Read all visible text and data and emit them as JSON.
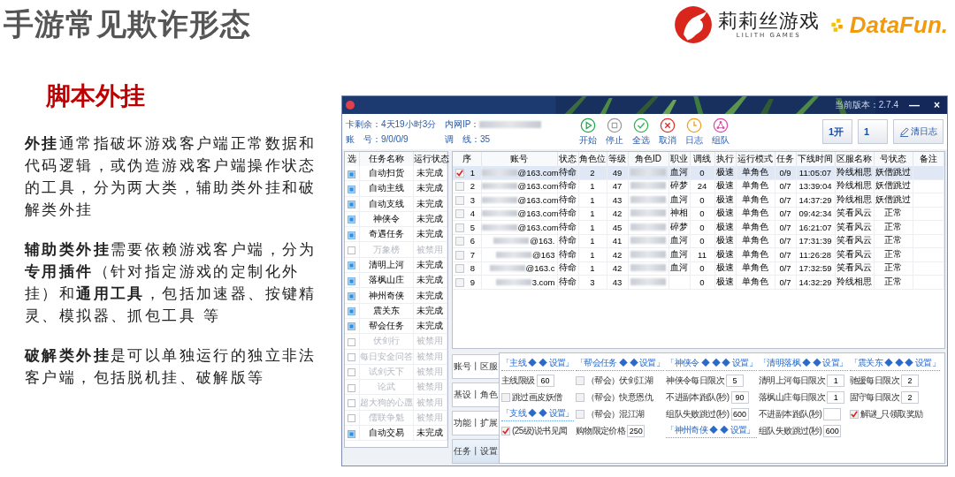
{
  "slide": {
    "title": "手游常见欺诈形态",
    "lilith_name": "莉莉丝游戏",
    "lilith_sub": "LILITH GAMES",
    "datafun": "DataFun."
  },
  "heading": "脚本外挂",
  "paragraphs": [
    "**外挂**通常指破坏游戏客户端正常数据和代码逻辑，或伪造游戏客户端操作状态的工具，分为两大类，辅助类外挂和破解类外挂",
    "**辅助类外挂**需要依赖游戏客户端，分为**专用插件**（针对指定游戏的定制化外挂）和**通用工具**，包括加速器、按键精灵、模拟器、抓包工具 等",
    "**破解类外挂**是可以单独运行的独立非法客户端，包括脱机挂、破解版等"
  ],
  "app_window": {
    "version": "当前版本：2.7.4",
    "minimize": "—",
    "close": "×",
    "info": [
      {
        "label": "卡剩余：",
        "value": "4天19小时3分"
      },
      {
        "label": "账　号：",
        "value": "9/0/0/9"
      },
      {
        "label": "内网IP：",
        "redacted": true
      },
      {
        "label": "调　线：",
        "value": "35"
      }
    ],
    "toolbar": [
      {
        "kind": "play",
        "label": "开始"
      },
      {
        "kind": "stop",
        "label": "停止"
      },
      {
        "kind": "check",
        "label": "全选"
      },
      {
        "kind": "cancel",
        "label": "取消"
      },
      {
        "kind": "log",
        "label": "日志"
      },
      {
        "kind": "team",
        "label": "组队"
      }
    ],
    "right_buttons": [
      "1开",
      "1"
    ],
    "clear_log": "清日志",
    "task_list": {
      "columns": [
        "选",
        "任务名称",
        "运行状态"
      ],
      "rows": [
        {
          "checked": true,
          "disabled": false,
          "name": "自动扫货",
          "status": "未完成"
        },
        {
          "checked": true,
          "disabled": false,
          "name": "自动主线",
          "status": "未完成"
        },
        {
          "checked": true,
          "disabled": false,
          "name": "自动支线",
          "status": "未完成"
        },
        {
          "checked": true,
          "disabled": false,
          "name": "神侠令",
          "status": "未完成"
        },
        {
          "checked": true,
          "disabled": false,
          "name": "奇遇任务",
          "status": "未完成"
        },
        {
          "checked": false,
          "disabled": true,
          "name": "万象榜",
          "status": "被禁用"
        },
        {
          "checked": true,
          "disabled": false,
          "name": "清明上河",
          "status": "未完成"
        },
        {
          "checked": true,
          "disabled": false,
          "name": "落枫山庄",
          "status": "未完成"
        },
        {
          "checked": true,
          "disabled": false,
          "name": "神州奇侠",
          "status": "未完成"
        },
        {
          "checked": true,
          "disabled": false,
          "name": "震关东",
          "status": "未完成"
        },
        {
          "checked": true,
          "disabled": false,
          "name": "帮会任务",
          "status": "未完成"
        },
        {
          "checked": false,
          "disabled": true,
          "name": "伏剑行",
          "status": "被禁用"
        },
        {
          "checked": false,
          "disabled": true,
          "name": "每日安全问答",
          "status": "被禁用"
        },
        {
          "checked": false,
          "disabled": true,
          "name": "试剑天下",
          "status": "被禁用"
        },
        {
          "checked": false,
          "disabled": true,
          "name": "论武",
          "status": "被禁用"
        },
        {
          "checked": false,
          "disabled": true,
          "name": "超大狗的心愿",
          "status": "被禁用"
        },
        {
          "checked": false,
          "disabled": true,
          "name": "儒联争魁",
          "status": "被禁用"
        },
        {
          "checked": true,
          "disabled": false,
          "name": "自动交易",
          "status": "未完成"
        }
      ]
    },
    "accounts": {
      "columns": [
        "序",
        "账号",
        "状态",
        "角色位",
        "等级",
        "角色ID",
        "职业",
        "调线",
        "执行",
        "运行模式",
        "任务",
        "下线时间",
        "区服名称",
        "号状态",
        "备注"
      ],
      "rows": [
        {
          "selected": true,
          "checked": true,
          "index": "1",
          "account": "@163.com",
          "state": "待命",
          "slot": "2",
          "level_text": "49",
          "job": "血河",
          "line": "0",
          "exec": "极速",
          "mode": "单角色",
          "task": "0/9",
          "offline": "11:05:07",
          "server": "羚线相思",
          "account_status": "妖僧跳过"
        },
        {
          "selected": false,
          "checked": false,
          "index": "2",
          "account": "@163.com",
          "state": "待命",
          "slot": "1",
          "level_text": "47",
          "job": "碎梦",
          "line": "24",
          "exec": "极速",
          "mode": "单角色",
          "task": "0/7",
          "offline": "13:39:04",
          "server": "羚线相思",
          "account_status": "妖僧跳过"
        },
        {
          "selected": false,
          "checked": false,
          "index": "3",
          "account": "@163.com",
          "state": "待命",
          "slot": "1",
          "level_text": "43",
          "job": "血河",
          "line": "0",
          "exec": "极速",
          "mode": "单角色",
          "task": "0/7",
          "offline": "14:37:29",
          "server": "羚线相思",
          "account_status": "妖僧跳过"
        },
        {
          "selected": false,
          "checked": false,
          "index": "4",
          "account": "@163.com",
          "state": "待命",
          "slot": "1",
          "level_text": "42",
          "job": "神相",
          "line": "0",
          "exec": "极速",
          "mode": "单角色",
          "task": "0/7",
          "offline": "09:42:34",
          "server": "笑看风云",
          "account_status": "正常"
        },
        {
          "selected": false,
          "checked": false,
          "index": "5",
          "account": "@163.com",
          "state": "待命",
          "slot": "1",
          "level_text": "45",
          "job": "碎梦",
          "line": "0",
          "exec": "极速",
          "mode": "单角色",
          "task": "0/7",
          "offline": "16:21:07",
          "server": "笑看风云",
          "account_status": "正常"
        },
        {
          "selected": false,
          "checked": false,
          "index": "6",
          "account": "@163.",
          "state": "待命",
          "slot": "1",
          "level_text": "41",
          "job": "血河",
          "line": "0",
          "exec": "极速",
          "mode": "单角色",
          "task": "0/7",
          "offline": "17:31:39",
          "server": "笑看风云",
          "account_status": "正常"
        },
        {
          "selected": false,
          "checked": false,
          "index": "7",
          "account": "@163",
          "state": "待命",
          "slot": "1",
          "level_text": "42",
          "job": "血河",
          "line": "11",
          "exec": "极速",
          "mode": "单角色",
          "task": "0/7",
          "offline": "11:26:28",
          "server": "笑看风云",
          "account_status": "正常"
        },
        {
          "selected": false,
          "checked": false,
          "index": "8",
          "account": "@163.c",
          "state": "待命",
          "slot": "1",
          "level_text": "42",
          "job": "血河",
          "line": "0",
          "exec": "极速",
          "mode": "单角色",
          "task": "0/7",
          "offline": "17:32:59",
          "server": "笑看风云",
          "account_status": "正常"
        },
        {
          "selected": false,
          "checked": false,
          "index": "9",
          "account": "3.com",
          "state": "待命",
          "slot": "3",
          "level_text": "43",
          "line": "0",
          "exec": "极速",
          "mode": "单角色",
          "task": "0/7",
          "offline": "14:32:29",
          "server": "羚线相思",
          "account_status": "正常"
        }
      ]
    },
    "tabs": [
      {
        "label": "账号丨区服",
        "selected": false
      },
      {
        "label": "基设丨角色",
        "selected": false
      },
      {
        "label": "功能丨扩展",
        "selected": false
      },
      {
        "label": "任务丨设置",
        "selected": true
      }
    ],
    "settings_columns": [
      [
        {
          "title": "「主线 ◆ ◆ 设置」",
          "items": [
            {
              "kind": "field",
              "label": "主线限级",
              "value": "60"
            },
            {
              "kind": "checkbox",
              "label": "跳过画皮妖僧",
              "checked": false
            }
          ]
        },
        {
          "title": "「支线 ◆ ◆ 设置」",
          "items": [
            {
              "kind": "checkbox",
              "label": "(25级)说书见闻",
              "checked": true
            }
          ]
        }
      ],
      [
        {
          "title": "「帮会任务 ◆ ◆ 设置」",
          "items": [
            {
              "kind": "checkbox",
              "label": "（帮会）伏剑江湖",
              "checked": false
            },
            {
              "kind": "checkbox",
              "label": "（帮会）快意恩仇",
              "checked": false
            },
            {
              "kind": "checkbox",
              "label": "（帮会）混江湖",
              "checked": false
            },
            {
              "kind": "field",
              "label": "购物限定价格",
              "value": "250"
            }
          ]
        }
      ],
      [
        {
          "title": "「神侠令 ◆ ◆ ◆ 设置」",
          "items": [
            {
              "kind": "field",
              "label": "神侠令每日限次",
              "value": "5"
            },
            {
              "kind": "field",
              "label": "不进副本跑队(秒)",
              "value": "90"
            },
            {
              "kind": "field",
              "label": "组队失败跳过(秒)",
              "value": "600"
            }
          ]
        },
        {
          "title": "「神州奇侠 ◆ ◆ 设置」"
        }
      ],
      [
        {
          "title": "「清明落枫 ◆ ◆ 设置」",
          "items": [
            {
              "kind": "field",
              "label": "清明上河每日限次",
              "value": "1"
            },
            {
              "kind": "field",
              "label": "落枫山庄每日限次",
              "value": "1"
            },
            {
              "kind": "field",
              "label": "不进副本跑队(秒)"
            },
            {
              "kind": "field",
              "label": "组队失败跳过(秒)",
              "value": "600"
            }
          ]
        }
      ],
      [
        {
          "title": "「震关东 ◆ ◆ ◆ 设置」",
          "items": [
            {
              "kind": "field",
              "label": "驰援每日限次",
              "value": "2"
            },
            {
              "kind": "field",
              "label": "固守每日限次",
              "value": "2"
            },
            {
              "kind": "checkbox",
              "label": "解谜_只领取奖励",
              "checked": true
            }
          ]
        }
      ]
    ]
  }
}
